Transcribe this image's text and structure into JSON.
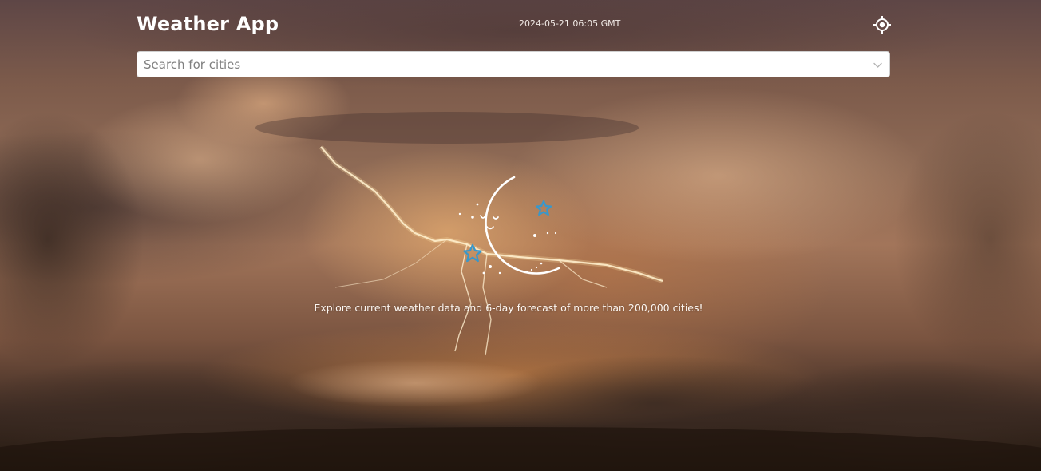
{
  "app": {
    "title": "Weather App",
    "datetime": "2024-05-21 06:05 GMT"
  },
  "header": {
    "locate_icon": "crosshair-locate-icon"
  },
  "search": {
    "placeholder": "Search for cities",
    "value": "",
    "dropdown_icon": "chevron-down-icon"
  },
  "empty_state": {
    "illustration": "moon-with-stars-illustration",
    "message": "Explore current weather data and 6-day forecast of more than 200,000 cities!"
  },
  "colors": {
    "star_accent": "#3a97c9",
    "text": "#ffffff",
    "search_bg": "#ffffff"
  }
}
